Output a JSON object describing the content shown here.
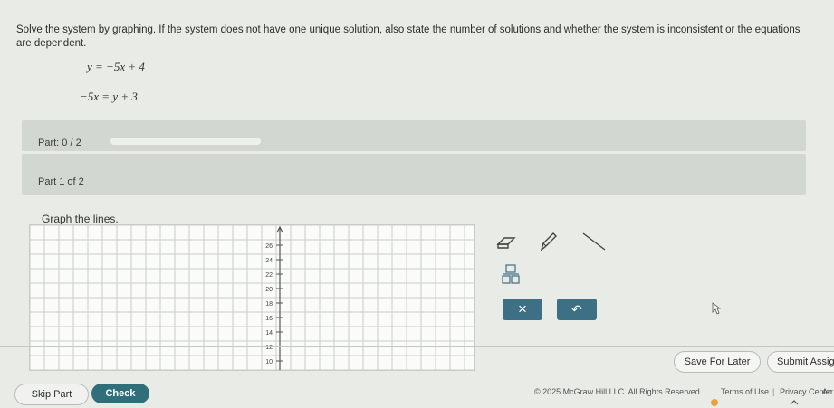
{
  "problem": {
    "prompt": "Solve the system by graphing. If the system does not have one unique solution, also state the number of solutions and whether the system is inconsistent or the equations are dependent.",
    "equation_1": "y = −5x + 4",
    "equation_2": "−5x = y + 3"
  },
  "progress": {
    "label": "Part: 0 / 2",
    "fraction": 0
  },
  "part": {
    "label": "Part 1 of 2",
    "instruction": "Graph the lines."
  },
  "graph": {
    "y_ticks": [
      "26",
      "24",
      "22",
      "20",
      "18",
      "16",
      "14",
      "12",
      "10"
    ]
  },
  "tools": {
    "eraser": "eraser-icon",
    "pencil": "pencil-icon",
    "line": "line-segment-icon",
    "fraction": "fraction-icon",
    "clear_symbol": "×",
    "undo_symbol": "↶"
  },
  "buttons": {
    "save_later": "Save For Later",
    "submit": "Submit Assig",
    "skip": "Skip Part",
    "check": "Check"
  },
  "footer": {
    "copyright": "© 2025 McGraw Hill LLC. All Rights Reserved.",
    "terms": "Terms of Use",
    "privacy": "Privacy Center",
    "extra": "Ac"
  },
  "colors": {
    "progress_fill": "#8fb38f",
    "tool_accent": "#3d6f85",
    "check_button": "#2f6f7a"
  }
}
